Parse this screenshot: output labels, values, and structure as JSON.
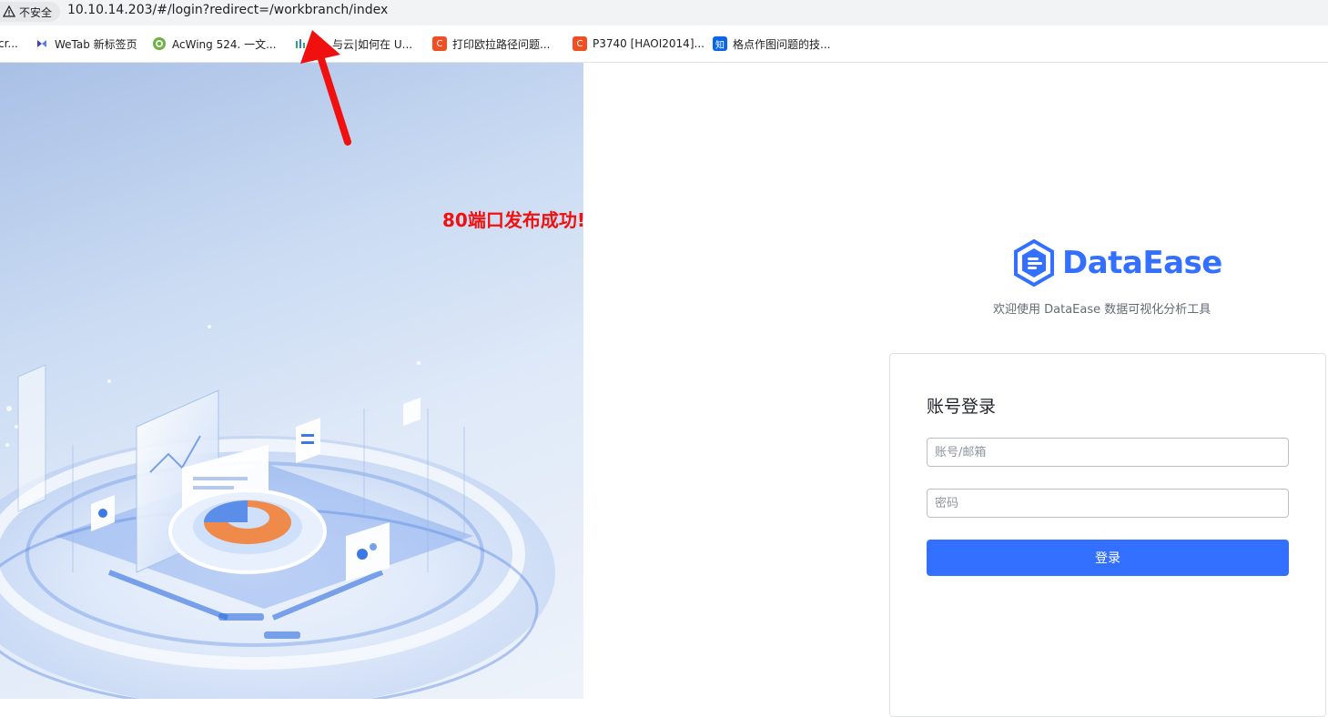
{
  "browser": {
    "security_label": "不安全",
    "url": "10.10.14.203/#/login?redirect=/workbranch/index"
  },
  "bookmarks": [
    {
      "label": "cr...",
      "icon": "none"
    },
    {
      "label": "WeTab 新标签页",
      "icon": "wetab-icon",
      "color": "#3b3fd8"
    },
    {
      "label": "AcWing 524. 一文...",
      "icon": "acwing-icon",
      "color": "#6cb33e"
    },
    {
      "label": "与云|如何在 U...",
      "icon": "bars-icon",
      "color": "#2aa876"
    },
    {
      "label": "打印欧拉路径问题...",
      "icon": "csdn-icon",
      "color": "#f04e23"
    },
    {
      "label": "P3740 [HAOI2014]...",
      "icon": "csdn-icon",
      "color": "#f04e23"
    },
    {
      "label": "格点作图问题的技...",
      "icon": "zhihu-icon",
      "color": "#0a66e6"
    }
  ],
  "annotation": {
    "text": "80端口发布成功!",
    "color": "#f01010"
  },
  "brand": {
    "name": "DataEase",
    "subtitle": "欢迎使用 DataEase 数据可视化分析工具",
    "accent": "#3370ff"
  },
  "login": {
    "title": "账号登录",
    "username_placeholder": "账号/邮箱",
    "username_value": "",
    "password_placeholder": "密码",
    "password_value": "",
    "submit_label": "登录"
  }
}
